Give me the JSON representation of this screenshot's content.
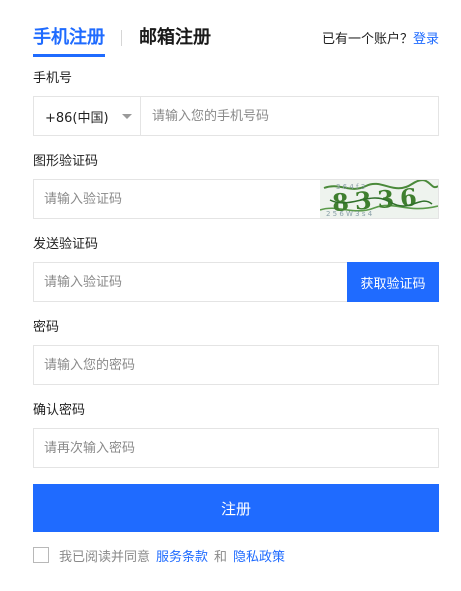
{
  "tabs": {
    "phone": "手机注册",
    "email": "邮箱注册"
  },
  "account": {
    "prompt": "已有一个账户？",
    "login": "登录"
  },
  "phone": {
    "label": "手机号",
    "country_code": "+86(中国)",
    "placeholder": "请输入您的手机号码"
  },
  "image_captcha": {
    "label": "图形验证码",
    "placeholder": "请输入验证码",
    "code_text": "8336"
  },
  "sms_code": {
    "label": "发送验证码",
    "placeholder": "请输入验证码",
    "button": "获取验证码"
  },
  "password": {
    "label": "密码",
    "placeholder": "请输入您的密码"
  },
  "confirm_password": {
    "label": "确认密码",
    "placeholder": "请再次输入密码"
  },
  "submit_label": "注册",
  "agreement": {
    "prefix": "我已阅读并同意",
    "terms": "服务条款",
    "and": "和",
    "privacy": "隐私政策"
  },
  "colors": {
    "accent": "#1f6bff",
    "border": "#e4e4e4"
  }
}
